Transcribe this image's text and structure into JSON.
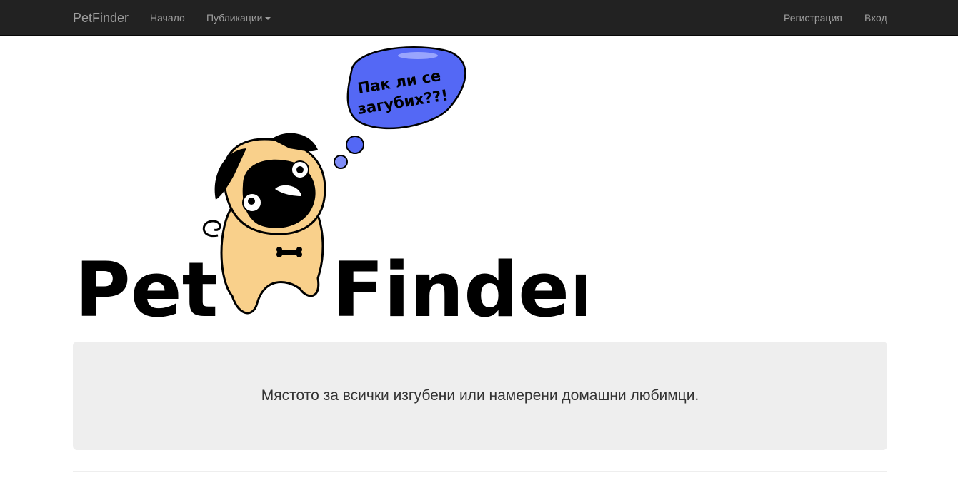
{
  "navbar": {
    "brand": "PetFinder",
    "links": {
      "home": "Начало",
      "publications": "Публикации",
      "register": "Регистрация",
      "login": "Вход"
    }
  },
  "logo": {
    "bubble_line1": "Пак ли се",
    "bubble_line2": "загубих??!",
    "word_left": "Pet",
    "word_right": "Finder",
    "colors": {
      "bubble": "#5468f5",
      "pug_fur": "#f9d08b",
      "ink": "#000000"
    }
  },
  "jumbotron": {
    "text": "Мястото за всички изгубени или намерени домашни любимци."
  }
}
